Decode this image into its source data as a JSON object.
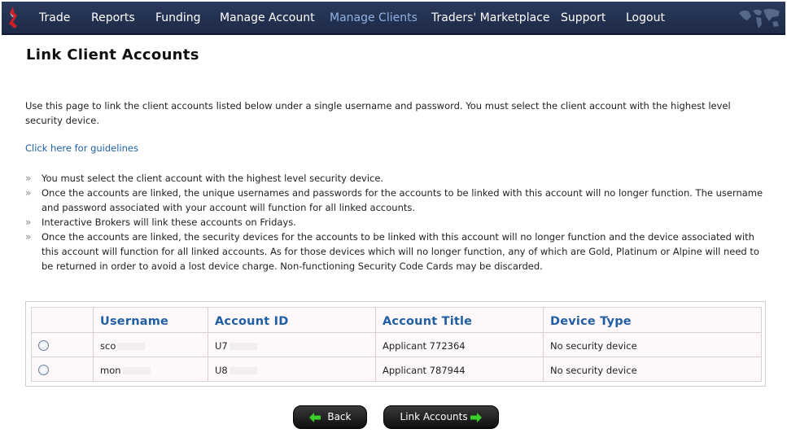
{
  "nav": {
    "items": [
      {
        "label": "Trade"
      },
      {
        "label": "Reports"
      },
      {
        "label": "Funding"
      },
      {
        "label": "Manage Account"
      },
      {
        "label": "Manage Clients"
      },
      {
        "label": "Traders' Marketplace"
      },
      {
        "label": "Support"
      },
      {
        "label": "Logout"
      }
    ],
    "active": "Manage Clients"
  },
  "page": {
    "title": "Link Client Accounts",
    "intro": "Use this page to link the client accounts listed below under a single username and password. You must select the client account with the highest level security device.",
    "guidelines_link": "Click here for guidelines",
    "bullet_marker": "»",
    "bullets": [
      "You must select the client account with the highest level security device.",
      "Once the accounts are linked, the unique usernames and passwords for the accounts to be linked with this account will no longer function. The username and password associated with your account will function for all linked accounts.",
      "Interactive Brokers will link these accounts on Fridays.",
      "Once the accounts are linked, the security devices for the accounts to be linked with this account will no longer function and the device associated with this account will function for all linked accounts. As for those devices which will no longer function, any of which are Gold, Platinum or Alpine will need to be returned in order to avoid a lost device charge. Non-functioning Security Code Cards may be discarded."
    ]
  },
  "table": {
    "headers": {
      "select": "",
      "username": "Username",
      "account_id": "Account ID",
      "account_title": "Account Title",
      "device_type": "Device Type"
    },
    "rows": [
      {
        "username": "sco",
        "account_id": "U7",
        "account_title": "Applicant 772364",
        "device_type": "No security device",
        "selected": false
      },
      {
        "username": "mon",
        "account_id": "U8",
        "account_title": "Applicant 787944",
        "device_type": "No security device",
        "selected": false
      }
    ]
  },
  "buttons": {
    "back": "Back",
    "link": "Link Accounts"
  },
  "colors": {
    "nav_bg": "#1d2a47",
    "nav_active": "#8fb2e3",
    "link": "#1f5fa5",
    "button_arrow": "#39d12a"
  }
}
